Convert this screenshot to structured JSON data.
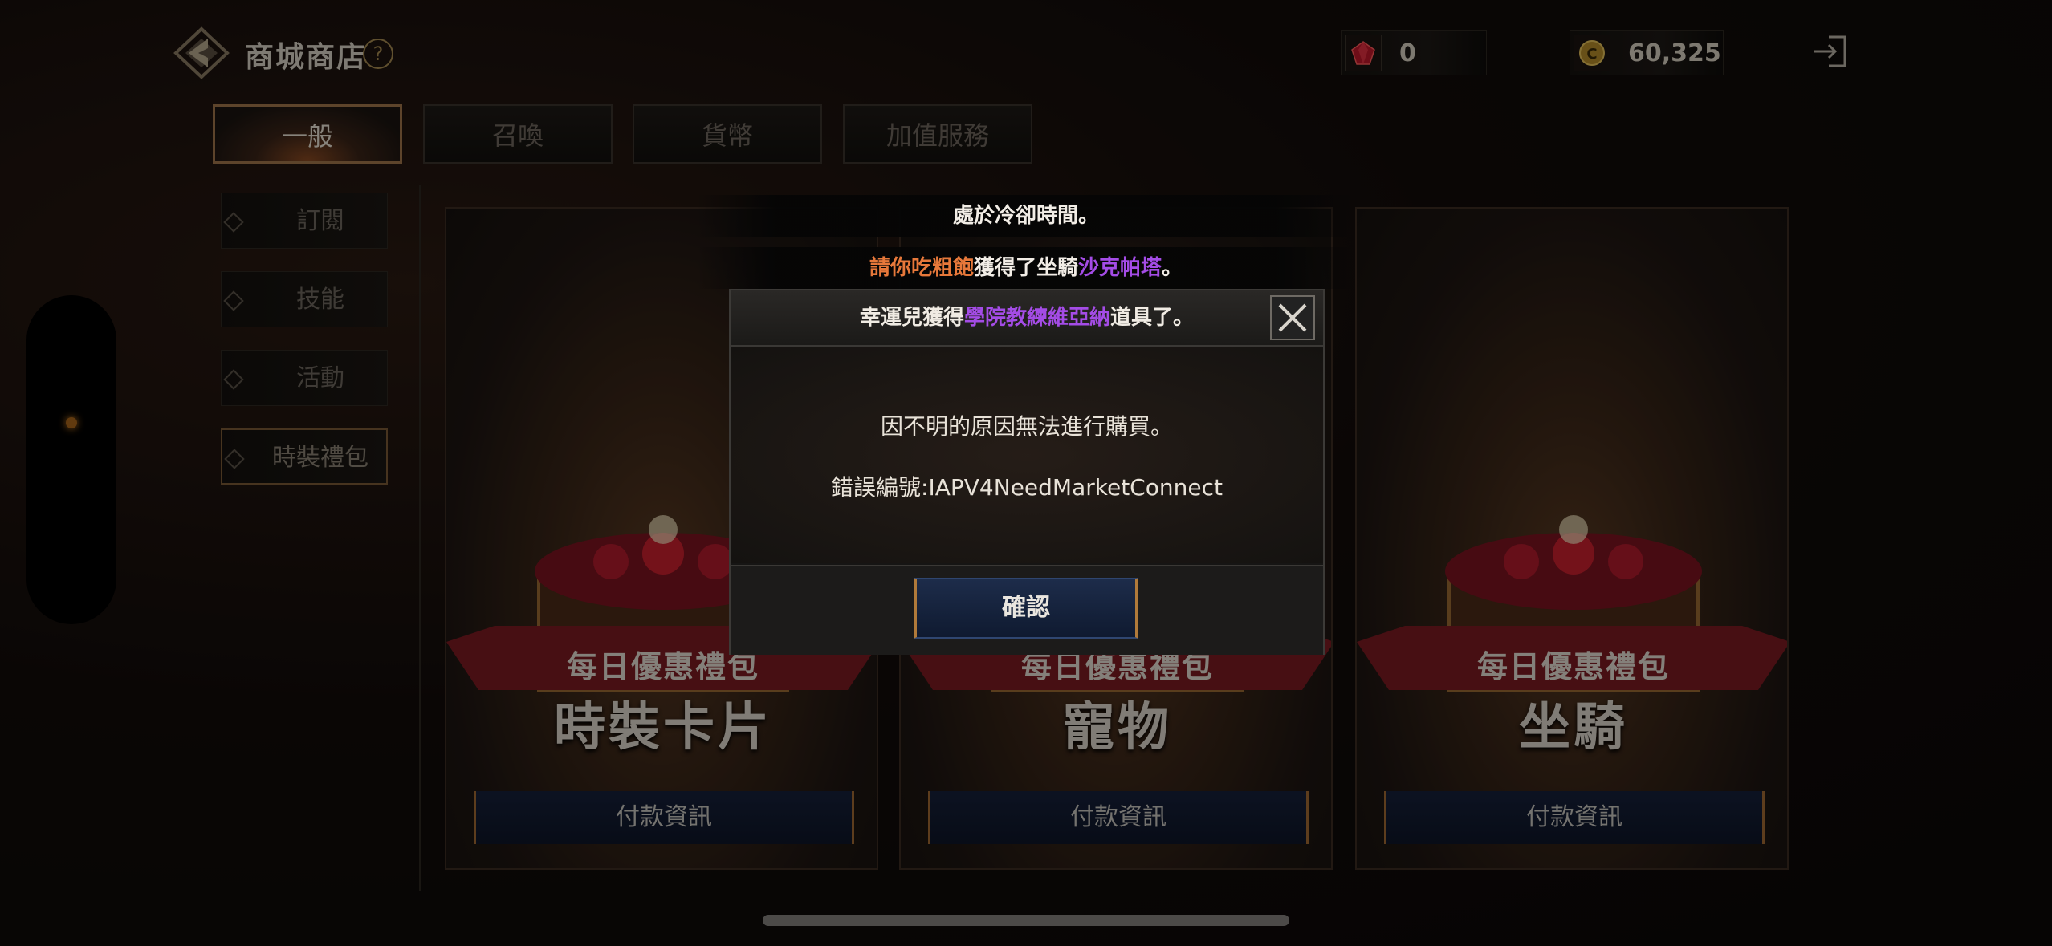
{
  "header": {
    "title": "商城商店",
    "help_icon": "?",
    "ruby_count": "0",
    "coin_count": "60,325",
    "icons": [
      "logo-icon",
      "help-icon",
      "ruby-icon",
      "coin-icon",
      "exit-icon"
    ]
  },
  "tabs": [
    {
      "label": "一般"
    },
    {
      "label": "召喚"
    },
    {
      "label": "貨幣"
    },
    {
      "label": "加值服務"
    }
  ],
  "sidebar": {
    "items": [
      {
        "label": "訂閱"
      },
      {
        "label": "技能"
      },
      {
        "label": "活動"
      },
      {
        "label": "時裝禮包"
      }
    ]
  },
  "cards": [
    {
      "subtitle": "每日優惠禮包",
      "name": "時裝卡片",
      "button": "付款資訊"
    },
    {
      "subtitle": "每日優惠禮包",
      "name": "寵物",
      "button": "付款資訊"
    },
    {
      "subtitle": "每日優惠禮包",
      "name": "坐騎",
      "button": "付款資訊"
    }
  ],
  "toasts": {
    "cooldown": "處於冷卻時間。",
    "mount_player": "請你吃粗飽",
    "mount_mid": "獲得了坐騎",
    "mount_name": "沙克帕塔",
    "mount_end": "。"
  },
  "dialog": {
    "head_prefix": "幸運兒獲得",
    "head_item": "學院教練維亞納",
    "head_suffix": "道具了。",
    "message": "因不明的原因無法進行購買。",
    "error_code": "錯誤編號:IAPV4NeedMarketConnect",
    "confirm_label": "確認"
  },
  "colors": {
    "player_name": "#e7783a",
    "item_name": "#a44ce6",
    "accent_gold": "#a0764a",
    "button_blue": "#16203a"
  }
}
